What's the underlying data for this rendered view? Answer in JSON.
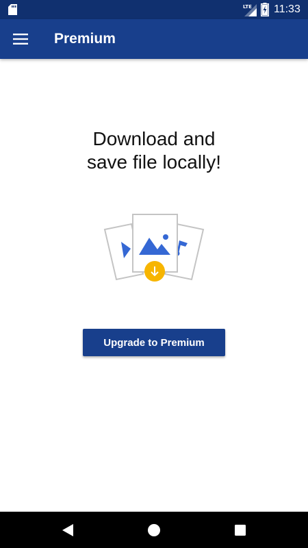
{
  "status_bar": {
    "time": "11:33",
    "network_label": "LTE",
    "icons": [
      "sd-card-icon",
      "lte-signal-icon",
      "battery-charging-icon"
    ]
  },
  "app_bar": {
    "title": "Premium",
    "menu_icon": "hamburger-menu-icon"
  },
  "main": {
    "headline_line1": "Download and",
    "headline_line2": "save file locally!",
    "illustration_icon": "download-files-illustration",
    "upgrade_button_label": "Upgrade to Premium"
  },
  "nav_bar": {
    "icons": [
      "back-icon",
      "home-icon",
      "recents-icon"
    ]
  },
  "colors": {
    "status_bar": "#10306f",
    "app_bar": "#183f8c",
    "button": "#183f8c",
    "illustration_blue": "#3568d4",
    "download_badge": "#f7b500"
  }
}
